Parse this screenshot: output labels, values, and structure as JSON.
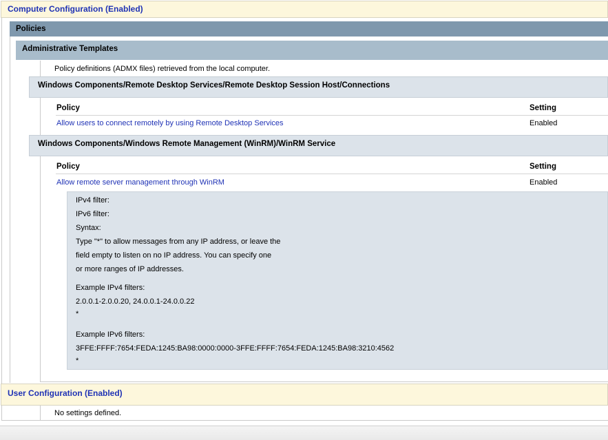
{
  "computer_config": {
    "title": "Computer Configuration (Enabled)"
  },
  "policies": {
    "title": "Policies"
  },
  "admin_templates": {
    "title": "Administrative Templates",
    "description": "Policy definitions (ADMX files) retrieved from the local computer."
  },
  "categories": [
    {
      "title": "Windows Components/Remote Desktop Services/Remote Desktop Session Host/Connections",
      "col_policy": "Policy",
      "col_setting": "Setting",
      "rows": [
        {
          "policy": "Allow users to connect remotely by using Remote Desktop Services",
          "setting": "Enabled"
        }
      ]
    },
    {
      "title": "Windows Components/Windows Remote Management (WinRM)/WinRM Service",
      "col_policy": "Policy",
      "col_setting": "Setting",
      "rows": [
        {
          "policy": "Allow remote server management through WinRM",
          "setting": "Enabled"
        }
      ],
      "details": [
        "IPv4 filter:",
        "IPv6 filter:",
        "Syntax:",
        "Type \"*\" to allow messages from any IP address, or leave the",
        "field empty to listen on no IP address. You can specify one",
        "or more ranges of IP addresses.",
        "Example IPv4 filters:",
        "2.0.0.1-2.0.0.20, 24.0.0.1-24.0.0.22",
        "*",
        "Example IPv6 filters:",
        "3FFE:FFFF:7654:FEDA:1245:BA98:0000:0000-3FFE:FFFF:7654:FEDA:1245:BA98:3210:4562",
        "*"
      ]
    }
  ],
  "user_config": {
    "title": "User Configuration (Enabled)",
    "message": "No settings defined."
  }
}
